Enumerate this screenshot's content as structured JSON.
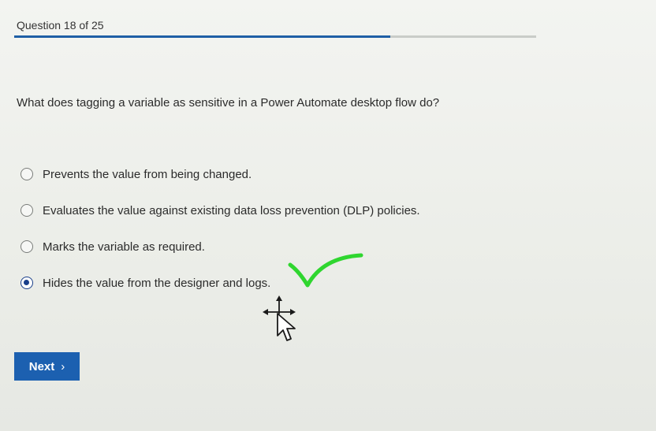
{
  "header": {
    "progress_label": "Question 18 of 25",
    "progress_fraction": 0.72
  },
  "question": {
    "text": "What does tagging a variable as sensitive in a Power Automate desktop flow do?"
  },
  "options": [
    {
      "label": "Prevents the value from being changed.",
      "selected": false
    },
    {
      "label": "Evaluates the value against existing data loss prevention (DLP) policies.",
      "selected": false
    },
    {
      "label": "Marks the variable as required.",
      "selected": false
    },
    {
      "label": "Hides the value from the designer and logs.",
      "selected": true
    }
  ],
  "footer": {
    "next_label": "Next",
    "next_icon": "chevron-right-icon"
  },
  "colors": {
    "accent": "#1c60b0",
    "check_mark": "#2fd62f"
  },
  "icons": {
    "cursor": "move-cursor-icon",
    "annotation": "checkmark-icon"
  }
}
